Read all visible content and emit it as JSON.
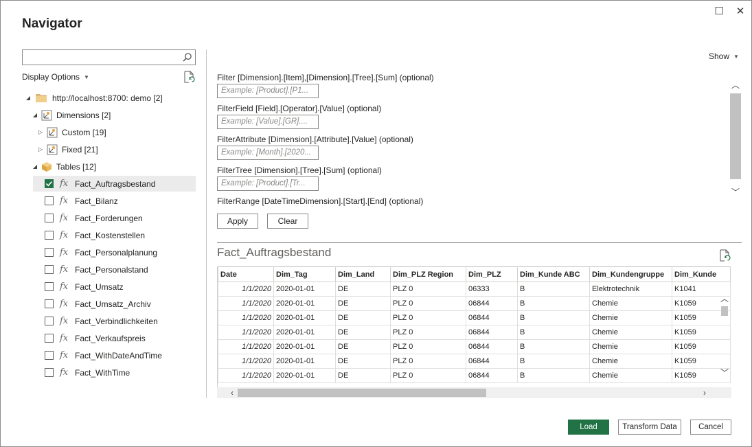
{
  "window": {
    "title": "Navigator",
    "maximize_glyph": "☐",
    "close_glyph": "✕"
  },
  "left": {
    "search": {
      "value": "",
      "placeholder": ""
    },
    "display_options_label": "Display Options",
    "tree": {
      "root": {
        "label": "http://localhost:8700: demo [2]"
      },
      "dimensions": {
        "label": "Dimensions [2]"
      },
      "custom": {
        "label": "Custom [19]"
      },
      "fixed": {
        "label": "Fixed [21]"
      },
      "tables": {
        "label": "Tables [12]"
      },
      "items": [
        {
          "label": "Fact_Auftragsbestand",
          "checked": true
        },
        {
          "label": "Fact_Bilanz",
          "checked": false
        },
        {
          "label": "Fact_Forderungen",
          "checked": false
        },
        {
          "label": "Fact_Kostenstellen",
          "checked": false
        },
        {
          "label": "Fact_Personalplanung",
          "checked": false
        },
        {
          "label": "Fact_Personalstand",
          "checked": false
        },
        {
          "label": "Fact_Umsatz",
          "checked": false
        },
        {
          "label": "Fact_Umsatz_Archiv",
          "checked": false
        },
        {
          "label": "Fact_Verbindlichkeiten",
          "checked": false
        },
        {
          "label": "Fact_Verkaufspreis",
          "checked": false
        },
        {
          "label": "Fact_WithDateAndTime",
          "checked": false
        },
        {
          "label": "Fact_WithTime",
          "checked": false
        }
      ],
      "fx_glyph": "fx"
    }
  },
  "right": {
    "show_label": "Show",
    "params": [
      {
        "label": "Filter [Dimension].[Item],[Dimension].[Tree].[Sum] (optional)",
        "placeholder": "Example: [Product].[P1..."
      },
      {
        "label": "FilterField [Field].[Operator].[Value] (optional)",
        "placeholder": "Example: [Value].[GR]...."
      },
      {
        "label": "FilterAttribute [Dimension].[Attribute].[Value] (optional)",
        "placeholder": "Example: [Month].[2020..."
      },
      {
        "label": "FilterTree [Dimension].[Tree].[Sum] (optional)",
        "placeholder": "Example: [Product].[Tr..."
      },
      {
        "label": "FilterRange [DateTimeDimension].[Start].[End] (optional)",
        "placeholder": ""
      }
    ],
    "apply_label": "Apply",
    "clear_label": "Clear",
    "preview_title": "Fact_Auftragsbestand",
    "grid": {
      "columns": [
        "Date",
        "Dim_Tag",
        "Dim_Land",
        "Dim_PLZ Region",
        "Dim_PLZ",
        "Dim_Kunde ABC",
        "Dim_Kundengruppe",
        "Dim_Kunde"
      ],
      "rows": [
        [
          "1/1/2020",
          "2020-01-01",
          "DE",
          "PLZ 0",
          "06333",
          "B",
          "Elektrotechnik",
          "K1041"
        ],
        [
          "1/1/2020",
          "2020-01-01",
          "DE",
          "PLZ 0",
          "06844",
          "B",
          "Chemie",
          "K1059"
        ],
        [
          "1/1/2020",
          "2020-01-01",
          "DE",
          "PLZ 0",
          "06844",
          "B",
          "Chemie",
          "K1059"
        ],
        [
          "1/1/2020",
          "2020-01-01",
          "DE",
          "PLZ 0",
          "06844",
          "B",
          "Chemie",
          "K1059"
        ],
        [
          "1/1/2020",
          "2020-01-01",
          "DE",
          "PLZ 0",
          "06844",
          "B",
          "Chemie",
          "K1059"
        ],
        [
          "1/1/2020",
          "2020-01-01",
          "DE",
          "PLZ 0",
          "06844",
          "B",
          "Chemie",
          "K1059"
        ],
        [
          "1/1/2020",
          "2020-01-01",
          "DE",
          "PLZ 0",
          "06844",
          "B",
          "Chemie",
          "K1059"
        ]
      ]
    }
  },
  "footer": {
    "load_label": "Load",
    "transform_label": "Transform Data",
    "cancel_label": "Cancel"
  },
  "colors": {
    "accent": "#217346",
    "border": "#8a8886",
    "selection": "#ebebeb"
  }
}
